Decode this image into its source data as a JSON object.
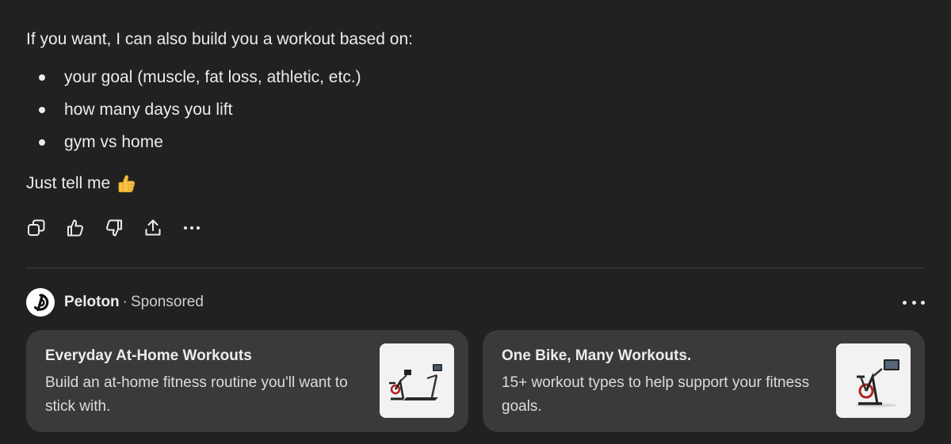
{
  "message": {
    "intro": "If you want, I can also build you a workout based on:",
    "bullets": [
      "your goal (muscle, fat loss, athletic, etc.)",
      "how many days you lift",
      "gym vs home"
    ],
    "outro": "Just tell me",
    "outro_emoji": "thumbs-up-emoji"
  },
  "actions": [
    {
      "name": "copy-button",
      "icon": "copy-icon"
    },
    {
      "name": "like-button",
      "icon": "thumbs-up-icon"
    },
    {
      "name": "dislike-button",
      "icon": "thumbs-down-icon"
    },
    {
      "name": "share-button",
      "icon": "share-icon"
    },
    {
      "name": "more-actions-button",
      "icon": "more-icon"
    }
  ],
  "ad": {
    "brand": "Peloton",
    "separator": "·",
    "label": "Sponsored",
    "logo_icon": "peloton-logo",
    "cards": [
      {
        "title": "Everyday At-Home Workouts",
        "description": "Build an at-home fitness routine you'll want to stick with.",
        "image": "treadmill-bike-product-image"
      },
      {
        "title": "One Bike, Many Workouts.",
        "description": "15+ workout types to help support your fitness goals.",
        "image": "exercise-bike-product-image"
      }
    ]
  },
  "colors": {
    "background": "#212121",
    "text": "#ececec",
    "card_background": "#3a3a3a",
    "divider": "#424242"
  }
}
